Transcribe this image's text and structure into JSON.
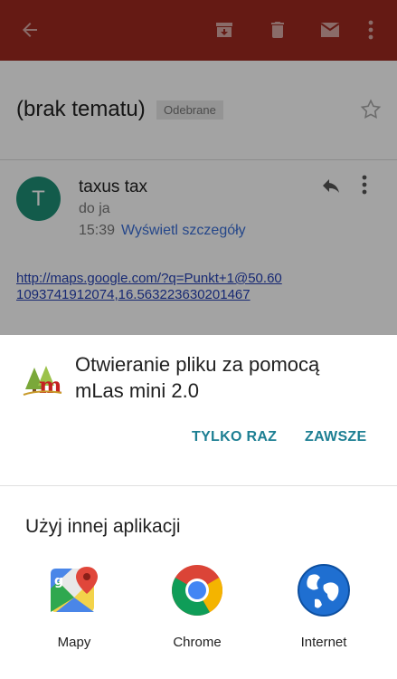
{
  "email": {
    "subject": "(brak tematu)",
    "label": "Odebrane",
    "sender_initial": "T",
    "sender_name": "taxus tax",
    "recipient": "do ja",
    "time": "15:39",
    "details_link": "Wyświetl szczegóły",
    "body_link": "http://maps.google.com/?q=Punkt+1@50.601093741912074,16.563223630201467"
  },
  "sheet": {
    "title": "Otwieranie pliku za pomocą mLas mini 2.0",
    "just_once": "TYLKO RAZ",
    "always": "ZAWSZE",
    "other_apps_heading": "Użyj innej aplikacji",
    "apps": [
      {
        "label": "Mapy",
        "icon": "google-maps-icon"
      },
      {
        "label": "Chrome",
        "icon": "chrome-icon"
      },
      {
        "label": "Internet",
        "icon": "internet-globe-icon"
      }
    ]
  },
  "colors": {
    "toolbar": "#9e2a20",
    "avatar": "#1e8f76",
    "accent_button": "#1d7f93",
    "link": "#2440b5"
  }
}
